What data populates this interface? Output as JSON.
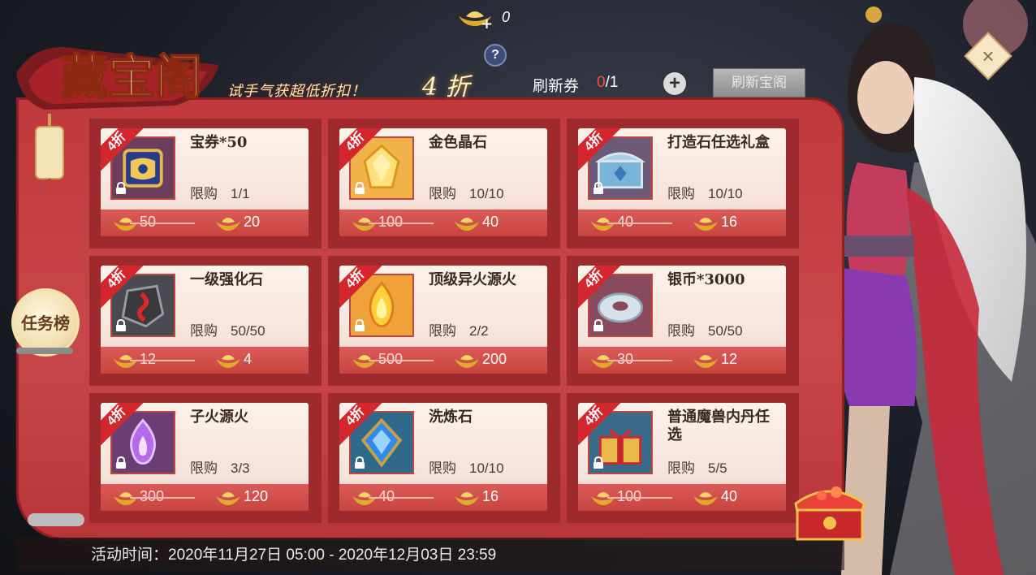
{
  "header": {
    "title": "藏宝阁",
    "slogan": "试手气获超低折扣！",
    "discount": "4 折",
    "help_symbol": "?",
    "top_currency_value": "0",
    "refresh_ticket_label": "刷新券",
    "refresh_ticket_used": "0",
    "refresh_ticket_total": "/1",
    "add_symbol": "+",
    "refresh_button_label": "刷新宝阁",
    "close_symbol": "×"
  },
  "side": {
    "task_board_label": "任务榜"
  },
  "items": [
    {
      "badge": "4折",
      "name": "宝券*50",
      "limit_label": "限购",
      "limit": "1/1",
      "old_price": "50",
      "new_price": "20",
      "icon": "ticket-icon"
    },
    {
      "badge": "4折",
      "name": "金色晶石",
      "limit_label": "限购",
      "limit": "10/10",
      "old_price": "100",
      "new_price": "40",
      "icon": "gold-crystal-icon"
    },
    {
      "badge": "4折",
      "name": "打造石任选礼盒",
      "limit_label": "限购",
      "limit": "10/10",
      "old_price": "40",
      "new_price": "16",
      "icon": "gift-chest-icon"
    },
    {
      "badge": "4折",
      "name": "一级强化石",
      "limit_label": "限购",
      "limit": "50/50",
      "old_price": "12",
      "new_price": "4",
      "icon": "enhance-stone-icon"
    },
    {
      "badge": "4折",
      "name": "顶级异火源火",
      "limit_label": "限购",
      "limit": "2/2",
      "old_price": "500",
      "new_price": "200",
      "icon": "golden-flame-icon"
    },
    {
      "badge": "4折",
      "name": "银币*3000",
      "limit_label": "限购",
      "limit": "50/50",
      "old_price": "30",
      "new_price": "12",
      "icon": "silver-coin-icon"
    },
    {
      "badge": "4折",
      "name": "子火源火",
      "limit_label": "限购",
      "limit": "3/3",
      "old_price": "300",
      "new_price": "120",
      "icon": "purple-flame-icon"
    },
    {
      "badge": "4折",
      "name": "洗炼石",
      "limit_label": "限购",
      "limit": "10/10",
      "old_price": "40",
      "new_price": "16",
      "icon": "refine-stone-icon"
    },
    {
      "badge": "4折",
      "name": "普通魔兽内丹任选",
      "limit_label": "限购",
      "limit": "5/5",
      "old_price": "100",
      "new_price": "40",
      "icon": "gift-box-icon"
    }
  ],
  "footer": {
    "event_time": "活动时间：2020年11月27日 05:00 - 2020年12月03日 23:59"
  },
  "colors": {
    "panel_red": "#c0383c",
    "badge_red": "#d3272d",
    "used_count_red": "#ff4b45",
    "gold": "#f2c24a"
  }
}
